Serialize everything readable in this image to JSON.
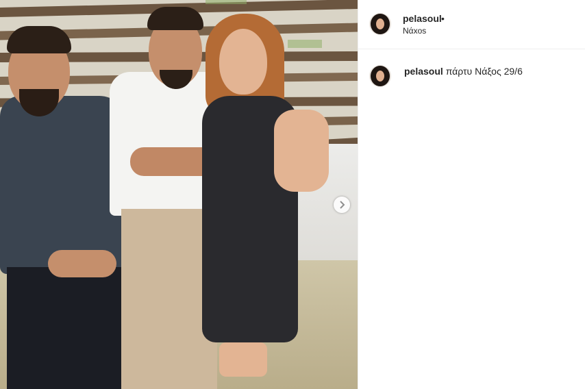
{
  "post": {
    "username": "pelasoul",
    "separator": "•",
    "location": "Νάxos",
    "caption_user": "pelasoul",
    "caption_text": "πάρτυ Νάξος 29/6"
  },
  "icons": {
    "carousel_next": "chevron-right-icon",
    "avatar": "profile-avatar"
  },
  "colors": {
    "text": "#262626",
    "divider": "#efefef"
  }
}
